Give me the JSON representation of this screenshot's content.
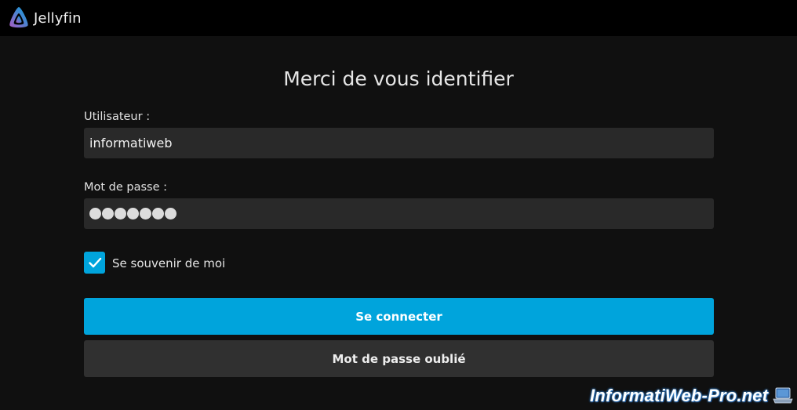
{
  "app": {
    "name": "Jellyfin",
    "accent_color": "#00a4dc"
  },
  "login": {
    "title": "Merci de vous identifier",
    "username_label": "Utilisateur :",
    "username_value": "informatiweb",
    "password_label": "Mot de passe :",
    "password_length": 7,
    "remember_label": "Se souvenir de moi",
    "remember_checked": true,
    "connect_label": "Se connecter",
    "forgot_label": "Mot de passe oublié"
  },
  "watermark": {
    "text": "InformatiWeb-Pro.net"
  }
}
